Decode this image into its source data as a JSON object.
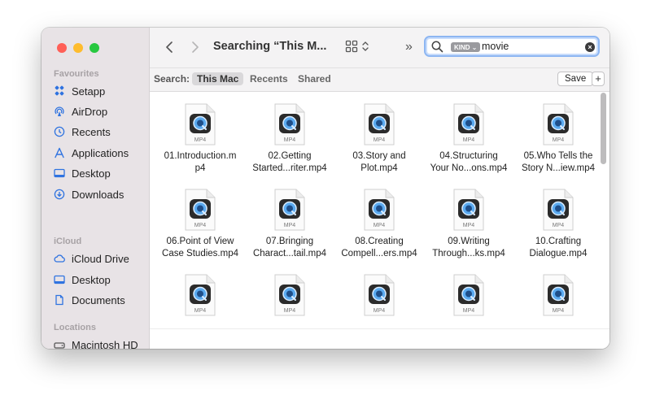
{
  "colors": {
    "close": "#ff5f57",
    "minimize": "#febc2e",
    "zoom": "#28c840",
    "accent": "#1e6fe0"
  },
  "sidebar": {
    "favourites_title": "Favourites",
    "favourites": [
      {
        "label": "Setapp",
        "icon": "setapp-icon"
      },
      {
        "label": "AirDrop",
        "icon": "airdrop-icon"
      },
      {
        "label": "Recents",
        "icon": "clock-icon"
      },
      {
        "label": "Applications",
        "icon": "applications-icon"
      },
      {
        "label": "Desktop",
        "icon": "desktop-icon"
      },
      {
        "label": "Downloads",
        "icon": "download-icon"
      }
    ],
    "icloud_title": "iCloud",
    "icloud": [
      {
        "label": "iCloud Drive",
        "icon": "cloud-icon"
      },
      {
        "label": "Desktop",
        "icon": "desktop-icon"
      },
      {
        "label": "Documents",
        "icon": "document-icon"
      }
    ],
    "locations_title": "Locations",
    "locations": [
      {
        "label": "Macintosh HD",
        "icon": "disk-icon"
      }
    ]
  },
  "toolbar": {
    "title": "Searching “This M...",
    "search": {
      "token": "KIND",
      "text": "movie"
    }
  },
  "scope": {
    "label": "Search:",
    "options": [
      "This Mac",
      "Recents",
      "Shared"
    ],
    "selected": "This Mac",
    "save_label": "Save",
    "add_label": "+"
  },
  "files": {
    "type_label": "MP4",
    "items": [
      {
        "line1": "01.Introduction.m",
        "line2": "p4"
      },
      {
        "line1": "02.Getting",
        "line2": "Started...riter.mp4"
      },
      {
        "line1": "03.Story and",
        "line2": "Plot.mp4"
      },
      {
        "line1": "04.Structuring",
        "line2": "Your No...ons.mp4"
      },
      {
        "line1": "05.Who Tells the",
        "line2": "Story N...iew.mp4"
      },
      {
        "line1": "06.Point of View",
        "line2": "Case Studies.mp4"
      },
      {
        "line1": "07.Bringing",
        "line2": "Charact...tail.mp4"
      },
      {
        "line1": "08.Creating",
        "line2": "Compell...ers.mp4"
      },
      {
        "line1": "09.Writing",
        "line2": "Through...ks.mp4"
      },
      {
        "line1": "10.Crafting",
        "line2": "Dialogue.mp4"
      },
      {
        "line1": "",
        "line2": ""
      },
      {
        "line1": "",
        "line2": ""
      },
      {
        "line1": "",
        "line2": ""
      },
      {
        "line1": "",
        "line2": ""
      },
      {
        "line1": "",
        "line2": ""
      }
    ]
  }
}
